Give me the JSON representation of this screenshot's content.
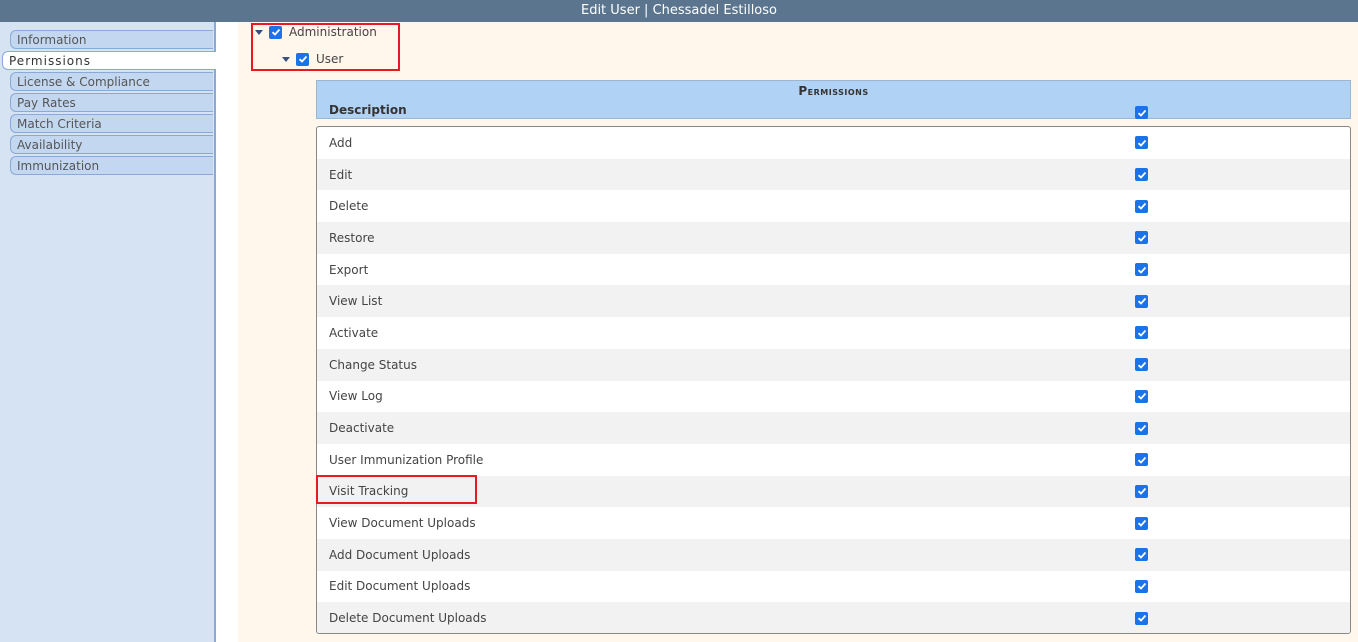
{
  "window": {
    "title": "Edit User | Chessadel Estilloso"
  },
  "sidebar": {
    "tabs": [
      {
        "label": "Information",
        "active": false
      },
      {
        "label": "Permissions",
        "active": true
      },
      {
        "label": "License & Compliance",
        "active": false
      },
      {
        "label": "Pay Rates",
        "active": false
      },
      {
        "label": "Match Criteria",
        "active": false
      },
      {
        "label": "Availability",
        "active": false
      },
      {
        "label": "Immunization",
        "active": false
      }
    ]
  },
  "tree": {
    "parent": {
      "label": "Administration",
      "checked": true,
      "expanded": true
    },
    "child": {
      "label": "User",
      "checked": true,
      "expanded": true
    }
  },
  "permissions": {
    "title": "Permissions",
    "column_description": "Description",
    "select_all_checked": true,
    "rows": [
      {
        "label": "Add",
        "checked": true
      },
      {
        "label": "Edit",
        "checked": true
      },
      {
        "label": "Delete",
        "checked": true
      },
      {
        "label": "Restore",
        "checked": true
      },
      {
        "label": "Export",
        "checked": true
      },
      {
        "label": "View List",
        "checked": true
      },
      {
        "label": "Activate",
        "checked": true
      },
      {
        "label": "Change Status",
        "checked": true
      },
      {
        "label": "View Log",
        "checked": true
      },
      {
        "label": "Deactivate",
        "checked": true
      },
      {
        "label": "User Immunization Profile",
        "checked": true
      },
      {
        "label": "Visit Tracking",
        "checked": true,
        "highlighted": true
      },
      {
        "label": "View Document Uploads",
        "checked": true
      },
      {
        "label": "Add Document Uploads",
        "checked": true
      },
      {
        "label": "Edit Document Uploads",
        "checked": true
      },
      {
        "label": "Delete Document Uploads",
        "checked": true
      }
    ]
  },
  "colors": {
    "titlebar": "#5b758f",
    "checkbox": "#1a73e8",
    "highlight": "#e8191f",
    "header": "#b0d2f4"
  }
}
